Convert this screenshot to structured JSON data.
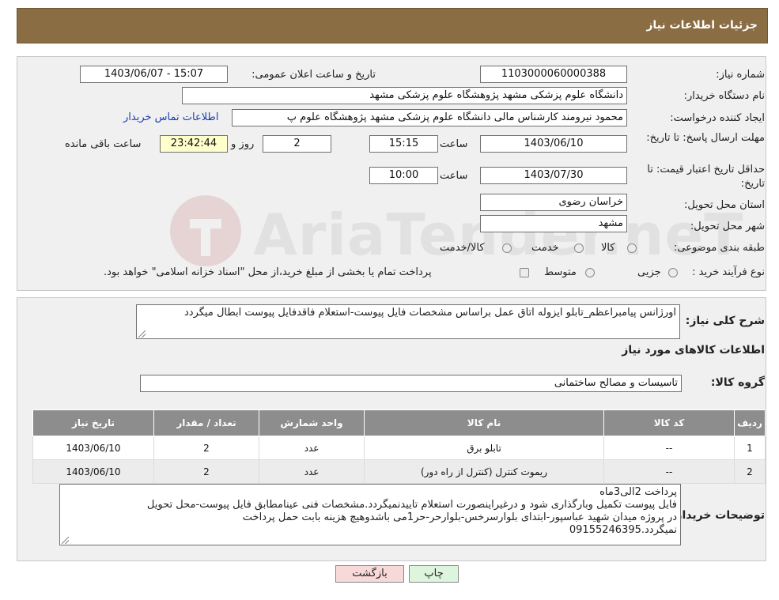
{
  "header": {
    "title": "جزئیات اطلاعات نیاز"
  },
  "form": {
    "need_number_label": "شماره نیاز:",
    "need_number": "1103000060000388",
    "announce_label": "تاریخ و ساعت اعلان عمومی:",
    "announce_value": "1403/06/07 - 15:07",
    "buyer_org_label": "نام دستگاه خریدار:",
    "buyer_org": "دانشگاه علوم پزشکی مشهد   پژوهشگاه علوم پزشکی مشهد",
    "creator_label": "ایجاد کننده درخواست:",
    "creator": "محمود نیرومند کارشناس مالی دانشگاه علوم پزشکی مشهد   پژوهشگاه علوم پ",
    "contact_link": "اطلاعات تماس خریدار",
    "deadline_label": "مهلت ارسال پاسخ: تا تاریخ:",
    "deadline_date": "1403/06/10",
    "time_label": "ساعت",
    "deadline_time": "15:15",
    "days_value": "2",
    "days_label": "روز و",
    "remaining_time": "23:42:44",
    "remaining_label": "ساعت باقی مانده",
    "validity_label": "حداقل تاریخ اعتبار قیمت: تا تاریخ:",
    "validity_date": "1403/07/30",
    "validity_time": "10:00",
    "province_label": "استان محل تحویل:",
    "province": "خراسان رضوی",
    "city_label": "شهر محل تحویل:",
    "city": "مشهد",
    "category_label": "طبقه بندی موضوعی:",
    "category_options": [
      "کالا",
      "خدمت",
      "کالا/خدمت"
    ],
    "process_label": "نوع فرآیند خرید :",
    "process_options": [
      "جزیی",
      "متوسط"
    ],
    "payment_note": "پرداخت تمام یا بخشی از مبلغ خرید،از محل \"اسناد خزانه اسلامی\" خواهد بود."
  },
  "description": {
    "label": "شرح کلی نیاز:",
    "text": "اورژانس پیامبراعظم_تابلو ایزوله اتاق عمل براساس مشخصات فایل پیوست-استعلام فاقدفایل پیوست ابطال میگردد"
  },
  "goods": {
    "section_title": "اطلاعات کالاهای مورد نیاز",
    "group_label": "گروه کالا:",
    "group_value": "تاسیسات و مصالح ساختمانی",
    "columns": [
      "ردیف",
      "کد کالا",
      "نام کالا",
      "واحد شمارش",
      "تعداد / مقدار",
      "تاریخ نیاز"
    ],
    "rows": [
      [
        "1",
        "--",
        "تابلو برق",
        "عدد",
        "2",
        "1403/06/10"
      ],
      [
        "2",
        "--",
        "ریموت کنترل (کنترل از راه دور)",
        "عدد",
        "2",
        "1403/06/10"
      ]
    ]
  },
  "buyer_notes": {
    "label": "توضیحات خریدار:",
    "line1": "پرداخت 2الی3ماه",
    "line2": "فایل پیوست تکمیل وبارگذاری شود و درغیراینصورت استعلام تاییدنمیگردد.مشخصات فنی عینامطابق فایل پیوست-محل تحویل",
    "line3": "در پروژه میدان شهید عباسپور-ابتدای بلوارسرخس-بلوارحر-حر1می باشدوهیچ هزینه بابت حمل  پرداخت",
    "line4": "نمیگردد.09155246395"
  },
  "buttons": {
    "print": "چاپ",
    "back": "بازگشت"
  },
  "watermark": {
    "text": "AriaTender.neT"
  },
  "colors": {
    "header_bg": "#8a6d43",
    "table_header": "#8d8d8d",
    "link": "#1a3fb0",
    "back_btn": "#f7d9d9"
  }
}
